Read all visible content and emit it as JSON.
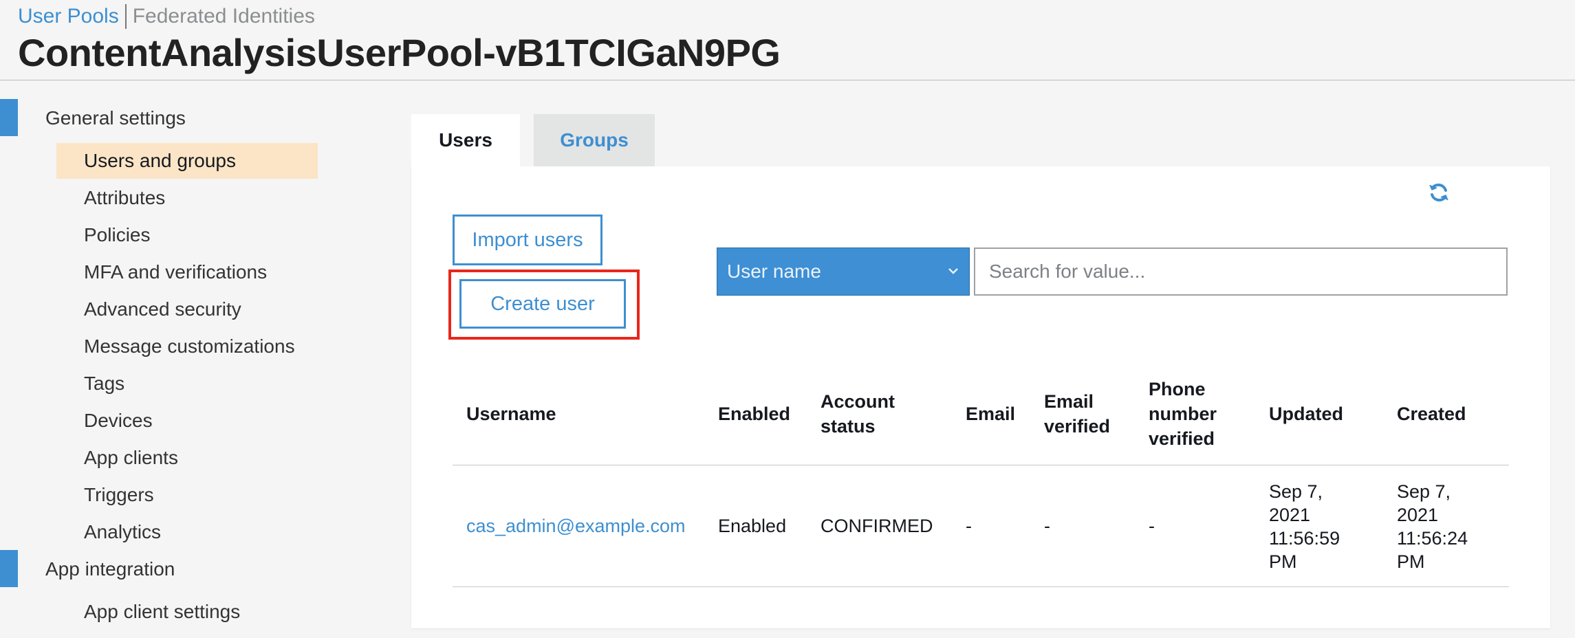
{
  "breadcrumb": {
    "user_pools": "User Pools",
    "federated_identities": "Federated Identities"
  },
  "page_title": "ContentAnalysisUserPool-vB1TCIGaN9PG",
  "sidebar": {
    "general_settings": "General settings",
    "items": [
      {
        "label": "Users and groups",
        "active": true
      },
      {
        "label": "Attributes"
      },
      {
        "label": "Policies"
      },
      {
        "label": "MFA and verifications"
      },
      {
        "label": "Advanced security"
      },
      {
        "label": "Message customizations"
      },
      {
        "label": "Tags"
      },
      {
        "label": "Devices"
      },
      {
        "label": "App clients"
      },
      {
        "label": "Triggers"
      },
      {
        "label": "Analytics"
      }
    ],
    "app_integration": "App integration",
    "app_integration_items": [
      {
        "label": "App client settings"
      }
    ]
  },
  "tabs": {
    "users": "Users",
    "groups": "Groups"
  },
  "actions": {
    "import_users": "Import users",
    "create_user": "Create user",
    "refresh_icon": "refresh-icon"
  },
  "search": {
    "attribute": "User name",
    "placeholder": "Search for value..."
  },
  "table": {
    "headers": {
      "username": "Username",
      "enabled": "Enabled",
      "account_status": "Account\nstatus",
      "email": "Email",
      "email_verified": "Email\nverified",
      "phone_verified": "Phone\nnumber\nverified",
      "updated": "Updated",
      "created": "Created"
    },
    "rows": [
      {
        "username": "cas_admin@example.com",
        "enabled": "Enabled",
        "account_status": "CONFIRMED",
        "email": "-",
        "email_verified": "-",
        "phone_verified": "-",
        "updated": "Sep 7,\n2021\n11:56:59\nPM",
        "created": "Sep 7,\n2021\n11:56:24\nPM"
      }
    ]
  },
  "colors": {
    "accent": "#3d8fd1",
    "active_nav": "#fbe5c6",
    "highlight": "#e8271b"
  }
}
